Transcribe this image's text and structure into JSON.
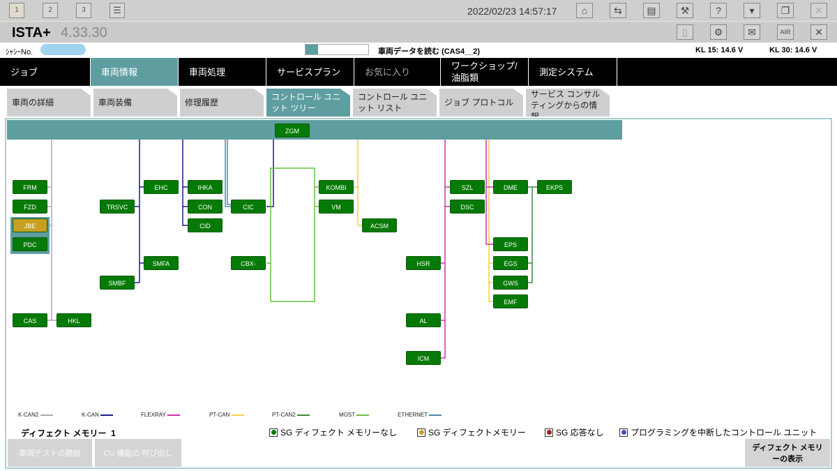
{
  "topbar": {
    "tabs": [
      "1",
      "2",
      "3"
    ],
    "datetime": "2022/02/23 14:57:17",
    "icons": [
      "home-icon",
      "connection-icon",
      "print-icon",
      "wrench-icon",
      "help-icon",
      "minimize-icon",
      "window-icon",
      "close-icon"
    ],
    "help_glyph": "?"
  },
  "title": {
    "app": "ISTA+",
    "version": "4.33.30",
    "close_glyph": "✕"
  },
  "info": {
    "chassis_label": "ｼｬｼｰNo.",
    "progress": 0.2,
    "status": "車両データを読む (CAS4__2)",
    "kl15": "KL 15:  14.6 V",
    "kl30": "KL 30:  14.6 V"
  },
  "nav": [
    "ジョブ",
    "車両情報",
    "車両処理",
    "サービスプラン",
    "お気に入り",
    "ワークショップ/ 油脂類",
    "測定システム"
  ],
  "subtabs": [
    "車両の詳細",
    "車両装備",
    "修理履歴",
    "コントロール ユニット ツリー",
    "コントロール ユニット リスト",
    "ジョブ プロトコル",
    "サービス コンサルティングからの情報"
  ],
  "units": [
    "ZGM",
    "FRM",
    "FZD",
    "JBE",
    "PDC",
    "CAS",
    "HKL",
    "TRSVC",
    "SMBF",
    "EHC",
    "SMFA",
    "IHKA",
    "CON",
    "CID",
    "CIC",
    "CBX-MEDIA",
    "KOMBI",
    "VM",
    "ACSM",
    "SZL",
    "DSC",
    "HSR",
    "AL",
    "ICM",
    "DME",
    "EKPS",
    "EPS",
    "EGS",
    "GWS",
    "EMF"
  ],
  "fault_unit": "JBE",
  "buses": [
    {
      "name": "K-CAN2",
      "color": "#aaaaaa"
    },
    {
      "name": "K-CAN",
      "color": "#1a1a8c"
    },
    {
      "name": "FLEXRAY",
      "color": "#d030b0"
    },
    {
      "name": "PT-CAN",
      "color": "#f0d040"
    },
    {
      "name": "PT-CAN2",
      "color": "#3a8a3a"
    },
    {
      "name": "MOST",
      "color": "#66c040"
    },
    {
      "name": "ETHERNET",
      "color": "#4a8ab0"
    }
  ],
  "fault_memory": {
    "label": "ディフェクト メモリー",
    "count": "1"
  },
  "status_legend": [
    {
      "label": "SG ディフェクト メモリーなし",
      "color": "#067a06"
    },
    {
      "label": "SG ディフェクトメモリー",
      "color": "#c8a020"
    },
    {
      "label": "SG 応答なし",
      "color": "#a02020"
    },
    {
      "label": "プログラミングを中断したコントロール ユニット",
      "color": "#4050c0"
    }
  ],
  "buttons": {
    "start_test": "車両テストの開始",
    "cu_call": "CU 機能の 呼び出し",
    "show_fault": "ディフェクト メモリーの表示"
  }
}
